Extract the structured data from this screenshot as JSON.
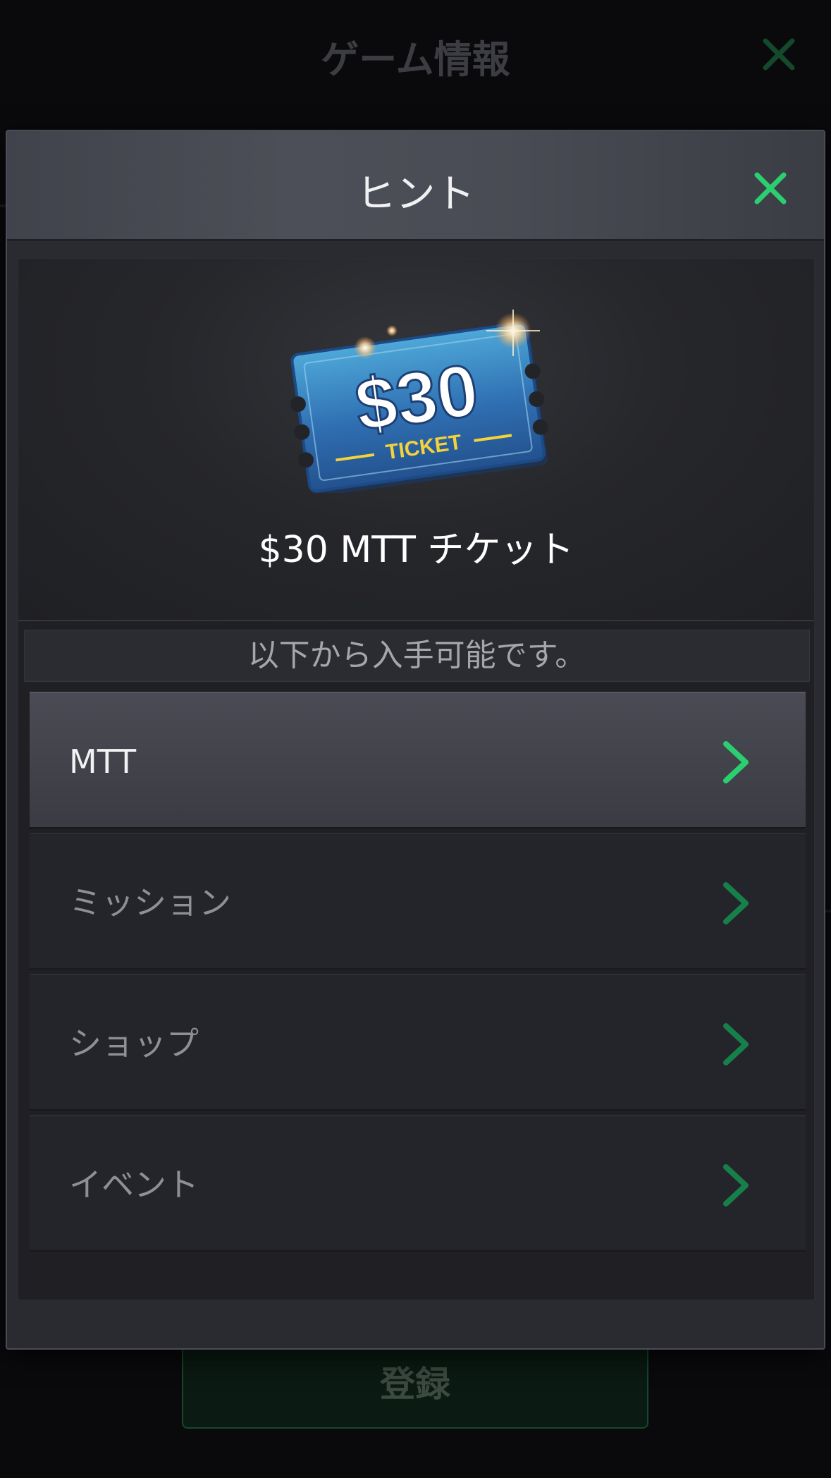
{
  "background": {
    "title": "ゲーム情報",
    "close_icon": "close-x-icon",
    "register_label": "登録"
  },
  "modal": {
    "title": "ヒント",
    "close_icon": "close-x-icon",
    "item": {
      "image": "ticket-icon",
      "ticket_amount": "$30",
      "ticket_word": "TICKET",
      "name": "$30 MTT チケット"
    },
    "sources_label": "以下から入手可能です。",
    "sources": [
      {
        "label": "MTT",
        "active": true
      },
      {
        "label": "ミッション",
        "active": false
      },
      {
        "label": "ショップ",
        "active": false
      },
      {
        "label": "イベント",
        "active": false
      }
    ]
  },
  "colors": {
    "accent_green": "#2ad06f",
    "dim_green": "#17804a"
  }
}
